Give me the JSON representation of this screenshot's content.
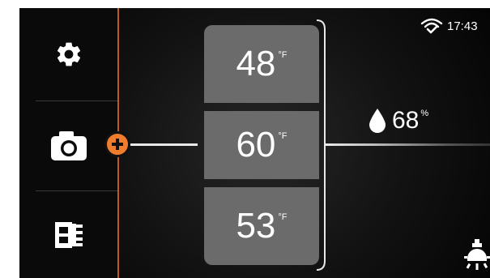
{
  "status_bar": {
    "time": "17:43",
    "wifi_icon": "wifi-check-icon"
  },
  "sidebar": {
    "items": [
      {
        "icon": "gear-icon"
      },
      {
        "icon": "camera-icon"
      },
      {
        "icon": "film-strip-icon"
      }
    ],
    "add_badge_icon": "plus-icon",
    "accent_color": "#f07d2d"
  },
  "temperatures": [
    {
      "value": "48",
      "unit": "°F"
    },
    {
      "value": "60",
      "unit": "°F"
    },
    {
      "value": "53",
      "unit": "°F"
    }
  ],
  "humidity": {
    "value": "68",
    "unit": "%",
    "icon": "water-drop-icon"
  },
  "light_icon": "lightbulb-icon"
}
